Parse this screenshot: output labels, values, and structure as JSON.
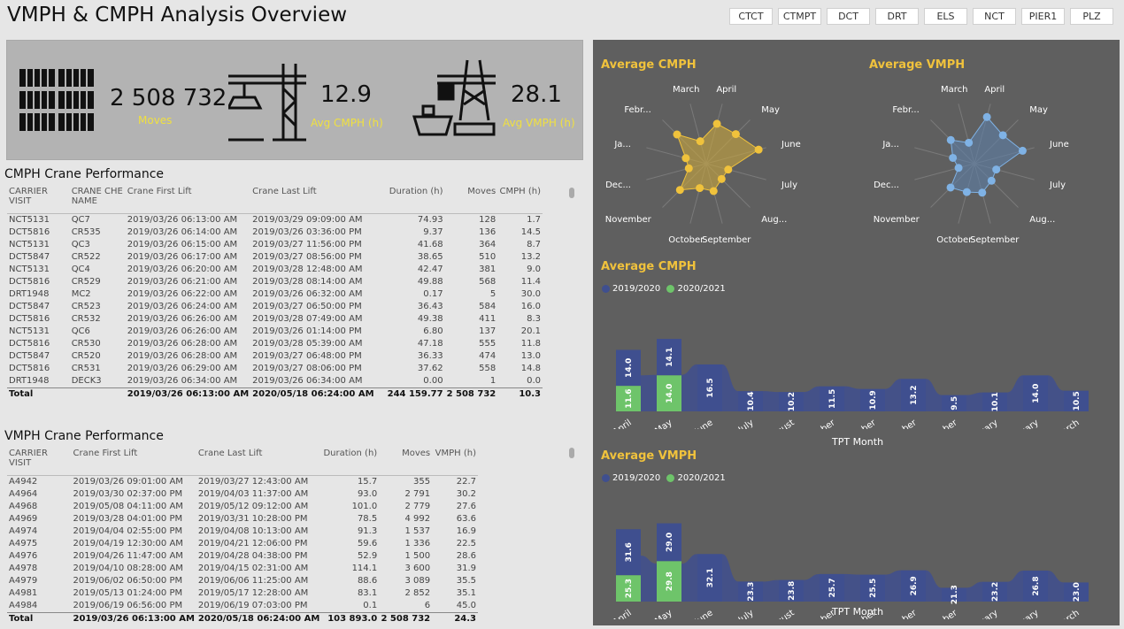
{
  "header": {
    "title": "VMPH & CMPH Analysis Overview"
  },
  "slicers": [
    "CTCT",
    "CTMPT",
    "DCT",
    "DRT",
    "ELS",
    "NCT",
    "PIER1",
    "PLZ"
  ],
  "kpis": {
    "moves_value": "2 508 732",
    "moves_label": "Moves",
    "cmph_value": "12.9",
    "cmph_label": "Avg CMPH (h)",
    "vmph_value": "28.1",
    "vmph_label": "Avg VMPH (h)"
  },
  "cmph_table": {
    "title": "CMPH Crane Performance",
    "headers": [
      "CARRIER VISIT",
      "CRANE CHE NAME",
      "Crane First Lift",
      "Crane Last Lift",
      "Duration (h)",
      "Moves",
      "CMPH (h)"
    ],
    "rows": [
      [
        "NCT5131",
        "QC7",
        "2019/03/26 06:13:00 AM",
        "2019/03/29 09:09:00 AM",
        "74.93",
        "128",
        "1.7"
      ],
      [
        "DCT5816",
        "CR535",
        "2019/03/26 06:14:00 AM",
        "2019/03/26 03:36:00 PM",
        "9.37",
        "136",
        "14.5"
      ],
      [
        "NCT5131",
        "QC3",
        "2019/03/26 06:15:00 AM",
        "2019/03/27 11:56:00 PM",
        "41.68",
        "364",
        "8.7"
      ],
      [
        "DCT5847",
        "CR522",
        "2019/03/26 06:17:00 AM",
        "2019/03/27 08:56:00 PM",
        "38.65",
        "510",
        "13.2"
      ],
      [
        "NCT5131",
        "QC4",
        "2019/03/26 06:20:00 AM",
        "2019/03/28 12:48:00 AM",
        "42.47",
        "381",
        "9.0"
      ],
      [
        "DCT5816",
        "CR529",
        "2019/03/26 06:21:00 AM",
        "2019/03/28 08:14:00 AM",
        "49.88",
        "568",
        "11.4"
      ],
      [
        "DRT1948",
        "MC2",
        "2019/03/26 06:22:00 AM",
        "2019/03/26 06:32:00 AM",
        "0.17",
        "5",
        "30.0"
      ],
      [
        "DCT5847",
        "CR523",
        "2019/03/26 06:24:00 AM",
        "2019/03/27 06:50:00 PM",
        "36.43",
        "584",
        "16.0"
      ],
      [
        "DCT5816",
        "CR532",
        "2019/03/26 06:26:00 AM",
        "2019/03/28 07:49:00 AM",
        "49.38",
        "411",
        "8.3"
      ],
      [
        "NCT5131",
        "QC6",
        "2019/03/26 06:26:00 AM",
        "2019/03/26 01:14:00 PM",
        "6.80",
        "137",
        "20.1"
      ],
      [
        "DCT5816",
        "CR530",
        "2019/03/26 06:28:00 AM",
        "2019/03/28 05:39:00 AM",
        "47.18",
        "555",
        "11.8"
      ],
      [
        "DCT5847",
        "CR520",
        "2019/03/26 06:28:00 AM",
        "2019/03/27 06:48:00 PM",
        "36.33",
        "474",
        "13.0"
      ],
      [
        "DCT5816",
        "CR531",
        "2019/03/26 06:29:00 AM",
        "2019/03/27 08:06:00 PM",
        "37.62",
        "558",
        "14.8"
      ],
      [
        "DRT1948",
        "DECK3",
        "2019/03/26 06:34:00 AM",
        "2019/03/26 06:34:00 AM",
        "0.00",
        "1",
        "0.0"
      ]
    ],
    "total": [
      "Total",
      "",
      "2019/03/26 06:13:00 AM",
      "2020/05/18 06:24:00 AM",
      "244 159.77",
      "2 508 732",
      "10.3"
    ]
  },
  "vmph_table": {
    "title": "VMPH Crane Performance",
    "headers": [
      "CARRIER VISIT",
      "Crane First Lift",
      "Crane Last Lift",
      "Duration (h)",
      "Moves",
      "VMPH (h)"
    ],
    "rows": [
      [
        "A4942",
        "2019/03/26 09:01:00 AM",
        "2019/03/27 12:43:00 AM",
        "15.7",
        "355",
        "22.7"
      ],
      [
        "A4964",
        "2019/03/30 02:37:00 PM",
        "2019/04/03 11:37:00 AM",
        "93.0",
        "2 791",
        "30.2"
      ],
      [
        "A4968",
        "2019/05/08 04:11:00 AM",
        "2019/05/12 09:12:00 AM",
        "101.0",
        "2 779",
        "27.6"
      ],
      [
        "A4969",
        "2019/03/28 04:01:00 PM",
        "2019/03/31 10:28:00 PM",
        "78.5",
        "4 992",
        "63.6"
      ],
      [
        "A4974",
        "2019/04/04 02:55:00 PM",
        "2019/04/08 10:13:00 AM",
        "91.3",
        "1 537",
        "16.9"
      ],
      [
        "A4975",
        "2019/04/19 12:30:00 AM",
        "2019/04/21 12:06:00 PM",
        "59.6",
        "1 336",
        "22.5"
      ],
      [
        "A4976",
        "2019/04/26 11:47:00 AM",
        "2019/04/28 04:38:00 PM",
        "52.9",
        "1 500",
        "28.6"
      ],
      [
        "A4978",
        "2019/04/10 08:28:00 AM",
        "2019/04/15 02:31:00 AM",
        "114.1",
        "3 600",
        "31.9"
      ],
      [
        "A4979",
        "2019/06/02 06:50:00 PM",
        "2019/06/06 11:25:00 AM",
        "88.6",
        "3 089",
        "35.5"
      ],
      [
        "A4981",
        "2019/05/13 01:24:00 PM",
        "2019/05/17 12:28:00 AM",
        "83.1",
        "2 852",
        "35.1"
      ],
      [
        "A4984",
        "2019/06/19 06:56:00 PM",
        "2019/06/19 07:03:00 PM",
        "0.1",
        "6",
        "45.0"
      ]
    ],
    "total": [
      "Total",
      "2019/03/26 06:13:00 AM",
      "2020/05/18 06:24:00 AM",
      "103 893.0",
      "2 508 732",
      "24.3"
    ]
  },
  "colors": {
    "accent_title": "#f0c23c",
    "series_2019": "#3f4f8f",
    "series_2020": "#6ec46a",
    "radar_cmph": "#f0c23c",
    "radar_vmph": "#7fb2e5",
    "panel_bg": "#5f5f5f",
    "kpi_label": "#f0e040"
  },
  "chart_data": [
    {
      "type": "radar",
      "title": "Average CMPH",
      "categories": [
        "April",
        "May",
        "June",
        "July",
        "August",
        "September",
        "October",
        "November",
        "December",
        "January",
        "February",
        "March"
      ],
      "values": [
        14.0,
        14.1,
        16.5,
        10.4,
        10.2,
        11.5,
        10.9,
        13.2,
        9.5,
        10.1,
        14.0,
        10.5
      ]
    },
    {
      "type": "radar",
      "title": "Average VMPH",
      "categories": [
        "April",
        "May",
        "June",
        "July",
        "August",
        "September",
        "October",
        "November",
        "December",
        "January",
        "February",
        "March"
      ],
      "values": [
        31.6,
        29.0,
        32.1,
        23.3,
        23.8,
        25.7,
        25.5,
        26.9,
        21.3,
        23.2,
        26.8,
        23.0
      ]
    },
    {
      "type": "bar",
      "title": "Average CMPH",
      "xlabel": "TPT Month",
      "categories": [
        "April",
        "May",
        "June",
        "July",
        "August",
        "September",
        "October",
        "November",
        "December",
        "January",
        "February",
        "March"
      ],
      "series": [
        {
          "name": "2019/2020",
          "values": [
            14.0,
            14.1,
            16.5,
            10.4,
            10.2,
            11.5,
            10.9,
            13.2,
            9.5,
            10.1,
            14.0,
            10.5
          ]
        },
        {
          "name": "2020/2021",
          "values": [
            11.6,
            14.0,
            null,
            null,
            null,
            null,
            null,
            null,
            null,
            null,
            null,
            null
          ]
        }
      ]
    },
    {
      "type": "bar",
      "title": "Average VMPH",
      "xlabel": "TPT Month",
      "categories": [
        "April",
        "May",
        "June",
        "July",
        "August",
        "September",
        "October",
        "November",
        "December",
        "January",
        "February",
        "March"
      ],
      "series": [
        {
          "name": "2019/2020",
          "values": [
            31.6,
            29.0,
            32.1,
            23.3,
            23.8,
            25.7,
            25.5,
            26.9,
            21.3,
            23.2,
            26.8,
            23.0
          ]
        },
        {
          "name": "2020/2021",
          "values": [
            25.3,
            29.8,
            null,
            null,
            null,
            null,
            null,
            null,
            null,
            null,
            null,
            null
          ]
        }
      ]
    }
  ]
}
